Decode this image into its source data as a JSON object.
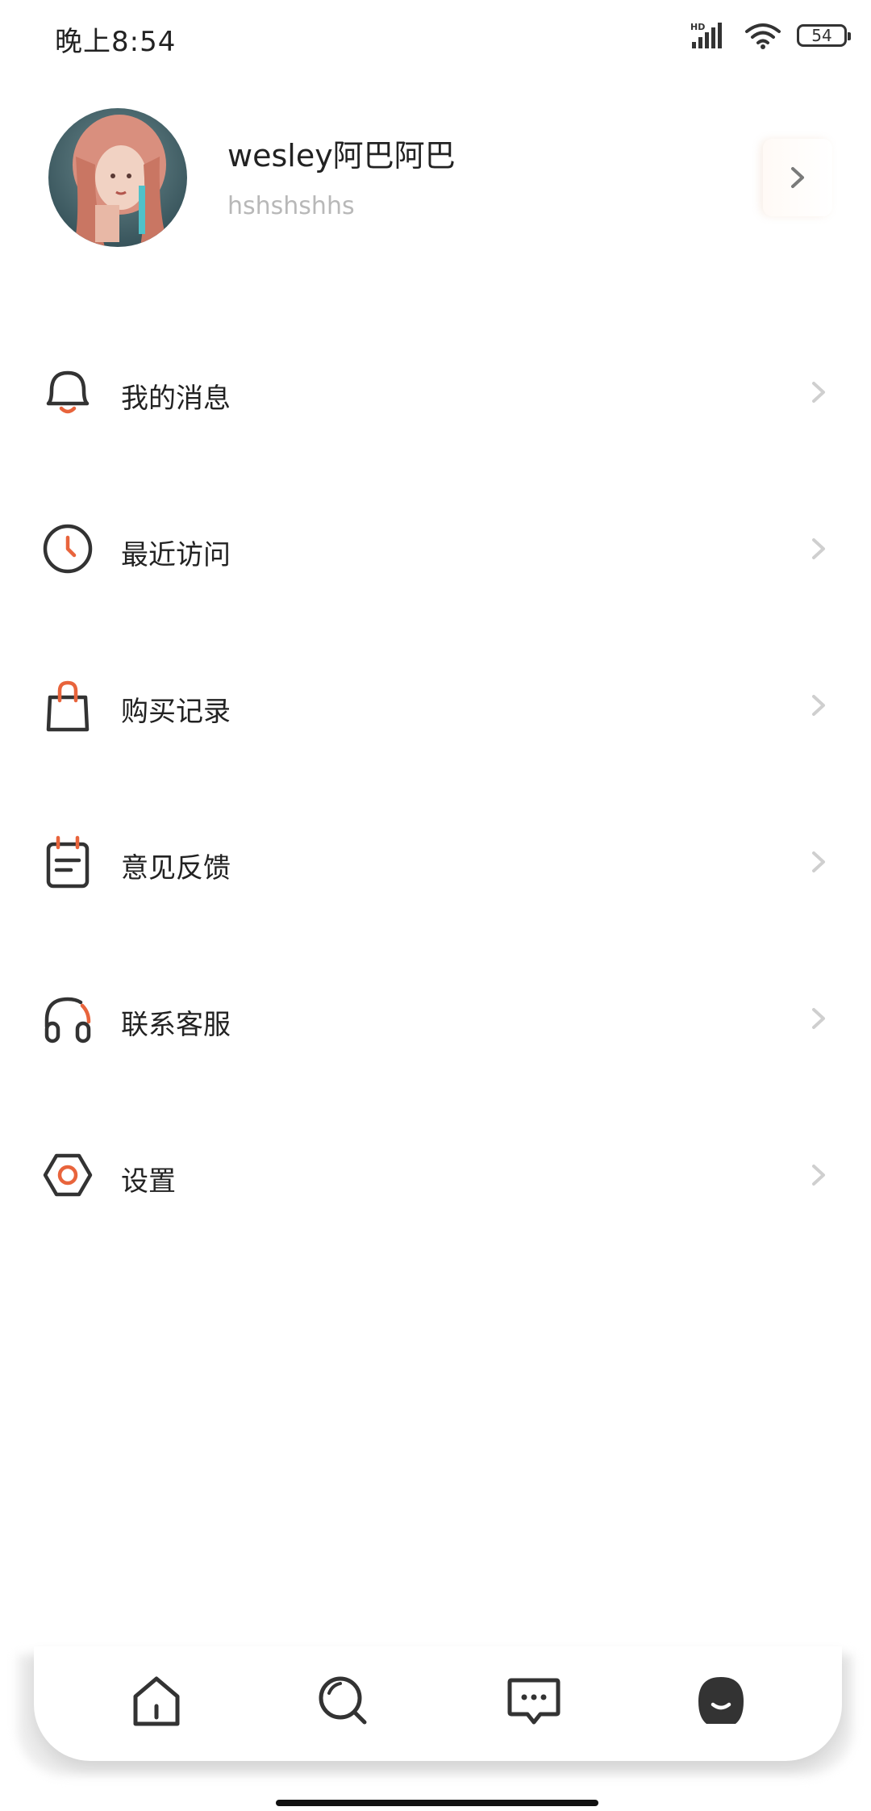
{
  "status_bar": {
    "time": "晚上8:54",
    "network_badge": "HD",
    "battery_level": "54",
    "icons": [
      "signal-icon",
      "wifi-icon",
      "battery-icon"
    ]
  },
  "profile": {
    "name": "wesley阿巴阿巴",
    "subtitle": "hshshshhs",
    "avatar": "avatar-photo",
    "arrow_icon": "chevron-right-icon"
  },
  "menu": {
    "items": [
      {
        "label": "我的消息",
        "icon": "bell-icon"
      },
      {
        "label": "最近访问",
        "icon": "clock-icon"
      },
      {
        "label": "购买记录",
        "icon": "shopping-bag-icon"
      },
      {
        "label": "意见反馈",
        "icon": "feedback-note-icon"
      },
      {
        "label": "联系客服",
        "icon": "headphones-icon"
      },
      {
        "label": "设置",
        "icon": "settings-hexagon-icon"
      }
    ]
  },
  "bottom_nav": {
    "items": [
      {
        "icon": "home-icon",
        "active": false
      },
      {
        "icon": "search-icon",
        "active": false
      },
      {
        "icon": "chat-icon",
        "active": false
      },
      {
        "icon": "profile-icon",
        "active": true
      }
    ]
  },
  "colors": {
    "accent": "#e8643c",
    "text": "#222222",
    "subtext": "#b8b8b8",
    "chevron": "#cfcfcf",
    "icon_stroke": "#333333"
  }
}
